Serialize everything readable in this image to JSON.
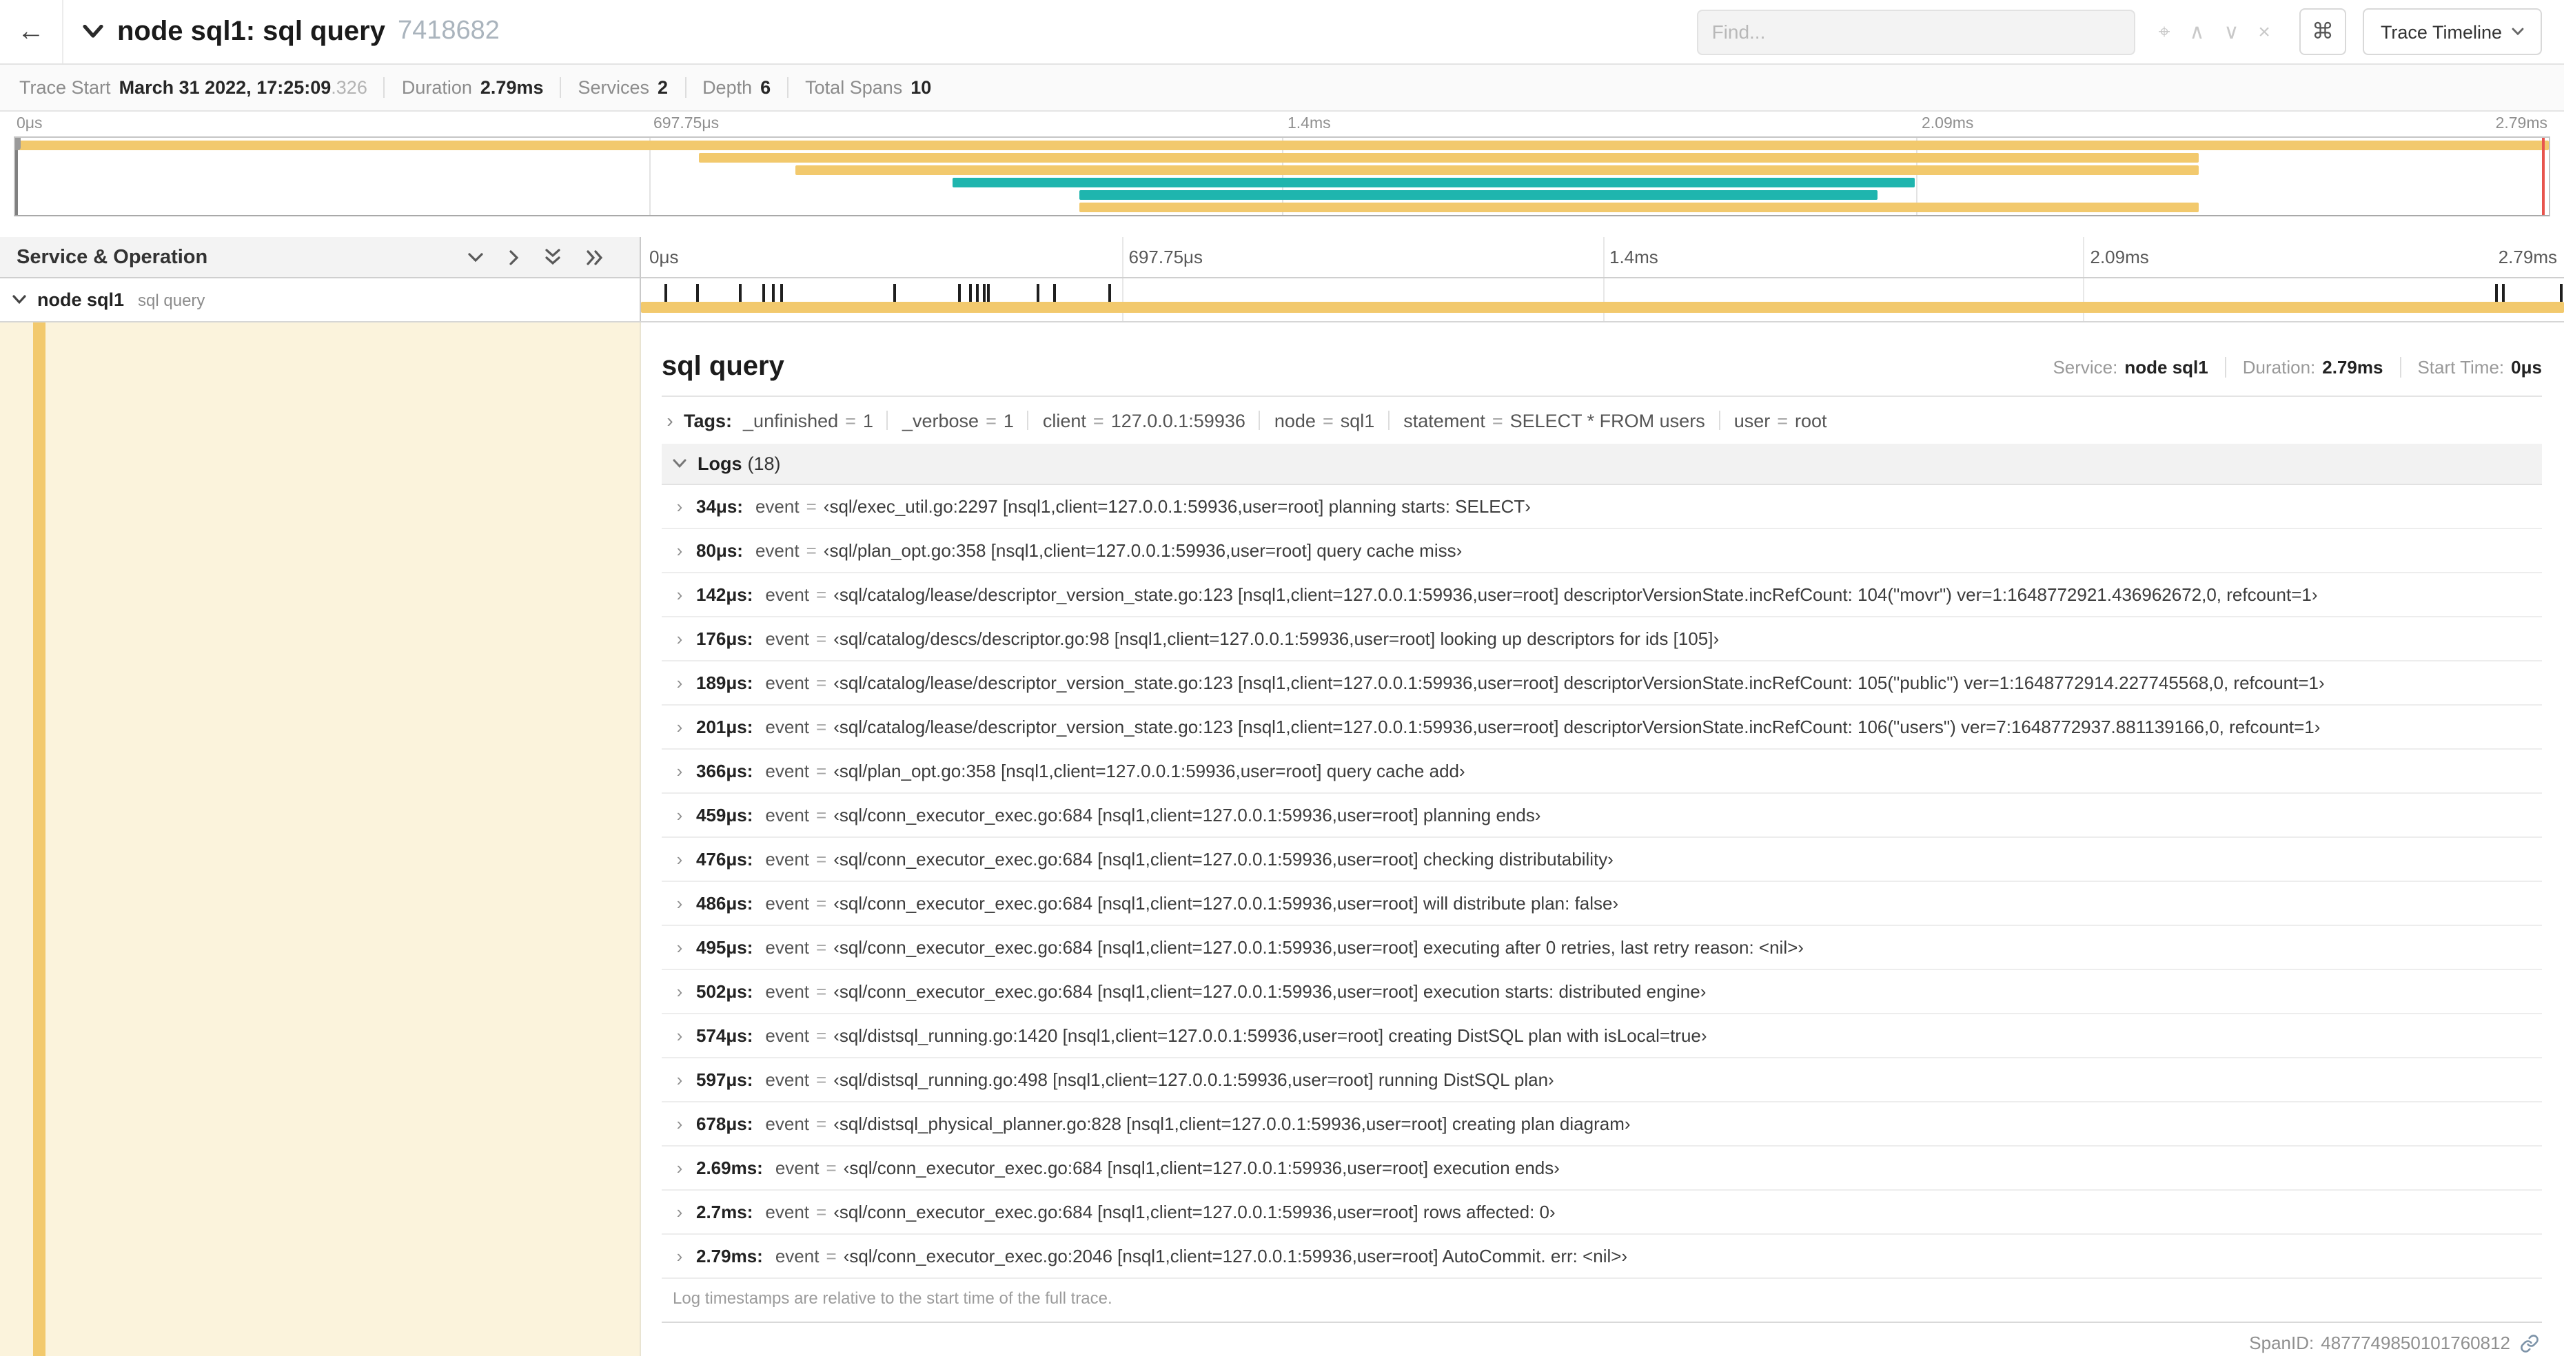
{
  "theme": {
    "tan": "#F2C96D",
    "teal": "#1FB5AE",
    "cursor_red": "#E8544D",
    "selected_row_bg": "#FBF3DC"
  },
  "icons": {
    "back": "←",
    "locate": "⌖",
    "find_prev": "∧",
    "find_next": "∨",
    "find_clear": "×",
    "keyboard": "⌘",
    "chevron_right": "›",
    "equals": "="
  },
  "header": {
    "title": "node sql1: sql query",
    "trace_id": "7418682",
    "find_placeholder": "Find...",
    "view_dropdown": "Trace Timeline"
  },
  "summary": {
    "items": [
      {
        "label": "Trace Start",
        "value": "March 31 2022, 17:25:09",
        "suffix": ".326"
      },
      {
        "label": "Duration",
        "value": "2.79ms"
      },
      {
        "label": "Services",
        "value": "2"
      },
      {
        "label": "Depth",
        "value": "6"
      },
      {
        "label": "Total Spans",
        "value": "10"
      }
    ]
  },
  "minimap": {
    "ticks": [
      "0μs",
      "697.75μs",
      "1.4ms",
      "2.09ms",
      "2.79ms"
    ],
    "bars": [
      {
        "row": 0,
        "start": 0.0,
        "end": 1.0,
        "color": "tan"
      },
      {
        "row": 1,
        "start": 0.27,
        "end": 0.862,
        "color": "tan"
      },
      {
        "row": 2,
        "start": 0.308,
        "end": 0.862,
        "color": "tan"
      },
      {
        "row": 3,
        "start": 0.37,
        "end": 0.75,
        "color": "teal"
      },
      {
        "row": 4,
        "start": 0.42,
        "end": 0.735,
        "color": "teal"
      },
      {
        "row": 5,
        "start": 0.42,
        "end": 0.862,
        "color": "tan"
      }
    ]
  },
  "timeline": {
    "left_header": "Service & Operation",
    "ruler_ticks": [
      "0μs",
      "697.75μs",
      "1.4ms",
      "2.09ms",
      "2.79ms"
    ],
    "span": {
      "service": "node sql1",
      "operation": "sql query",
      "total_us": 2790,
      "log_marks_us": [
        34,
        80,
        142,
        176,
        189,
        201,
        366,
        459,
        476,
        486,
        495,
        502,
        574,
        597,
        678,
        2690,
        2700,
        2790
      ]
    }
  },
  "detail": {
    "title": "sql query",
    "service_label": "Service:",
    "service_value": "node sql1",
    "duration_label": "Duration:",
    "duration_value": "2.79ms",
    "start_label": "Start Time:",
    "start_value": "0μs",
    "tags_label": "Tags:",
    "tags": [
      {
        "key": "_unfinished",
        "value": "1"
      },
      {
        "key": "_verbose",
        "value": "1"
      },
      {
        "key": "client",
        "value": "127.0.0.1:59936"
      },
      {
        "key": "node",
        "value": "sql1"
      },
      {
        "key": "statement",
        "value": "SELECT * FROM users"
      },
      {
        "key": "user",
        "value": "root"
      }
    ],
    "logs_label": "Logs",
    "logs_count": "(18)",
    "logs": [
      {
        "time": "34μs:",
        "key": "event",
        "value": "‹sql/exec_util.go:2297 [nsql1,client=127.0.0.1:59936,user=root] planning starts: SELECT›"
      },
      {
        "time": "80μs:",
        "key": "event",
        "value": "‹sql/plan_opt.go:358 [nsql1,client=127.0.0.1:59936,user=root] query cache miss›"
      },
      {
        "time": "142μs:",
        "key": "event",
        "value": "‹sql/catalog/lease/descriptor_version_state.go:123 [nsql1,client=127.0.0.1:59936,user=root] descriptorVersionState.incRefCount: 104(\"movr\") ver=1:1648772921.436962672,0, refcount=1›"
      },
      {
        "time": "176μs:",
        "key": "event",
        "value": "‹sql/catalog/descs/descriptor.go:98 [nsql1,client=127.0.0.1:59936,user=root] looking up descriptors for ids [105]›"
      },
      {
        "time": "189μs:",
        "key": "event",
        "value": "‹sql/catalog/lease/descriptor_version_state.go:123 [nsql1,client=127.0.0.1:59936,user=root] descriptorVersionState.incRefCount: 105(\"public\") ver=1:1648772914.227745568,0, refcount=1›"
      },
      {
        "time": "201μs:",
        "key": "event",
        "value": "‹sql/catalog/lease/descriptor_version_state.go:123 [nsql1,client=127.0.0.1:59936,user=root] descriptorVersionState.incRefCount: 106(\"users\") ver=7:1648772937.881139166,0, refcount=1›"
      },
      {
        "time": "366μs:",
        "key": "event",
        "value": "‹sql/plan_opt.go:358 [nsql1,client=127.0.0.1:59936,user=root] query cache add›"
      },
      {
        "time": "459μs:",
        "key": "event",
        "value": "‹sql/conn_executor_exec.go:684 [nsql1,client=127.0.0.1:59936,user=root] planning ends›"
      },
      {
        "time": "476μs:",
        "key": "event",
        "value": "‹sql/conn_executor_exec.go:684 [nsql1,client=127.0.0.1:59936,user=root] checking distributability›"
      },
      {
        "time": "486μs:",
        "key": "event",
        "value": "‹sql/conn_executor_exec.go:684 [nsql1,client=127.0.0.1:59936,user=root] will distribute plan: false›"
      },
      {
        "time": "495μs:",
        "key": "event",
        "value": "‹sql/conn_executor_exec.go:684 [nsql1,client=127.0.0.1:59936,user=root] executing after 0 retries, last retry reason: <nil>›"
      },
      {
        "time": "502μs:",
        "key": "event",
        "value": "‹sql/conn_executor_exec.go:684 [nsql1,client=127.0.0.1:59936,user=root] execution starts: distributed engine›"
      },
      {
        "time": "574μs:",
        "key": "event",
        "value": "‹sql/distsql_running.go:1420 [nsql1,client=127.0.0.1:59936,user=root] creating DistSQL plan with isLocal=true›"
      },
      {
        "time": "597μs:",
        "key": "event",
        "value": "‹sql/distsql_running.go:498 [nsql1,client=127.0.0.1:59936,user=root] running DistSQL plan›"
      },
      {
        "time": "678μs:",
        "key": "event",
        "value": "‹sql/distsql_physical_planner.go:828 [nsql1,client=127.0.0.1:59936,user=root] creating plan diagram›"
      },
      {
        "time": "2.69ms:",
        "key": "event",
        "value": "‹sql/conn_executor_exec.go:684 [nsql1,client=127.0.0.1:59936,user=root] execution ends›"
      },
      {
        "time": "2.7ms:",
        "key": "event",
        "value": "‹sql/conn_executor_exec.go:684 [nsql1,client=127.0.0.1:59936,user=root] rows affected: 0›"
      },
      {
        "time": "2.79ms:",
        "key": "event",
        "value": "‹sql/conn_executor_exec.go:2046 [nsql1,client=127.0.0.1:59936,user=root] AutoCommit. err: <nil>›"
      }
    ],
    "logs_footnote": "Log timestamps are relative to the start time of the full trace.",
    "span_id_label": "SpanID:",
    "span_id": "4877749850101760812"
  }
}
